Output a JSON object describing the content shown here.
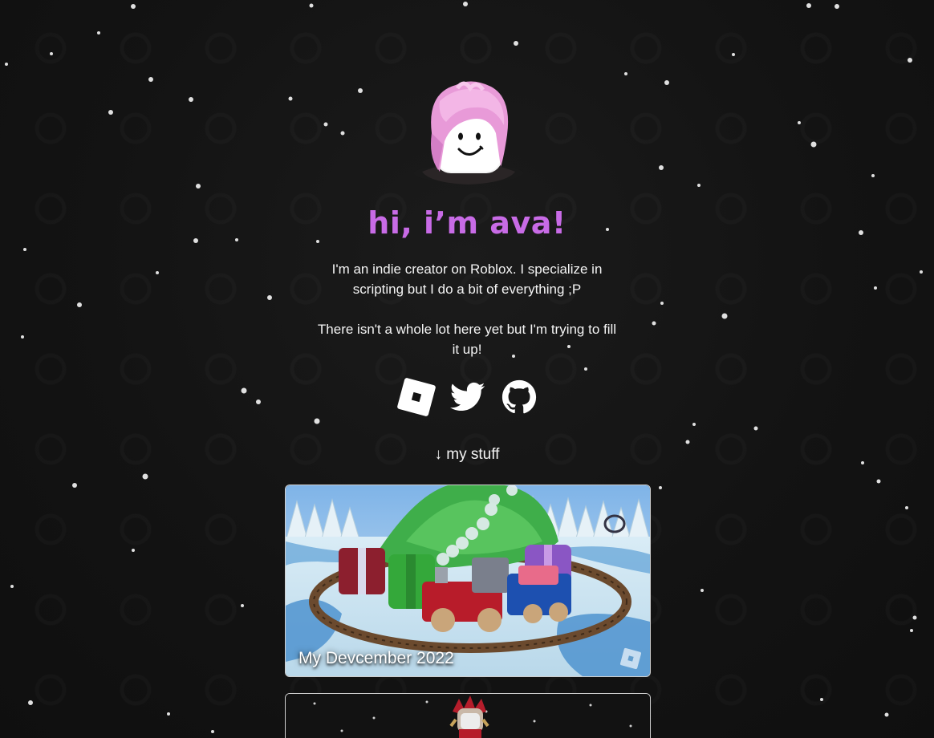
{
  "profile": {
    "greeting": "hi, i’m ava!",
    "bio": [
      "I'm an indie creator on Roblox. I specialize in scripting but I do a bit of everything ;P",
      "There isn't a whole lot here yet but I'm trying to fill it up!"
    ]
  },
  "socials": [
    {
      "name": "Roblox",
      "icon": "roblox-icon"
    },
    {
      "name": "Twitter",
      "icon": "twitter-icon"
    },
    {
      "name": "GitHub",
      "icon": "github-icon"
    }
  ],
  "section": {
    "label": "↓ my stuff"
  },
  "projects": [
    {
      "title": "My Devcember 2022",
      "platform_icon": "roblox-icon"
    },
    {
      "title": "",
      "platform_icon": ""
    }
  ],
  "colors": {
    "background": "#131313",
    "accent": "#c86be6",
    "text": "#f4f4f4",
    "card_border": "#cfcfcf"
  }
}
